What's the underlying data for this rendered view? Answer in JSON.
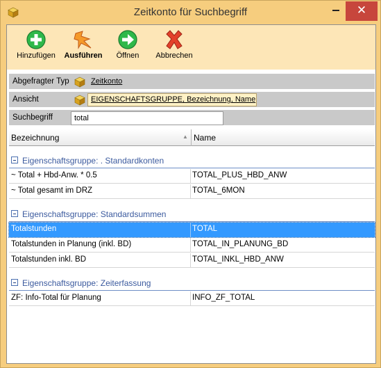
{
  "window": {
    "title": "Zeitkonto für Suchbegriff",
    "close_glyph": "✕",
    "accent_color": "#f6cd7e",
    "close_color": "#c7463c"
  },
  "toolbar": {
    "buttons": [
      {
        "label": "Hinzufügen",
        "icon": "add-icon"
      },
      {
        "label": "Ausführen",
        "icon": "execute-icon"
      },
      {
        "label": "Öffnen",
        "icon": "open-arrow-icon"
      },
      {
        "label": "Abbrechen",
        "icon": "cancel-x-icon"
      }
    ]
  },
  "props": {
    "typ_label": "Abgefragter Typ",
    "typ_value": "Zeitkonto",
    "ansicht_label": "Ansicht",
    "ansicht_value": "EIGENSCHAFTSGRUPPE, Bezeichnung, Name",
    "suchbegriff_label": "Suchbegriff",
    "suchbegriff_value": "total"
  },
  "grid": {
    "columns": [
      "Bezeichnung",
      "Name"
    ],
    "sort_glyph": "▲",
    "groups": [
      {
        "label": "Eigenschaftsgruppe: . Standardkonten",
        "rows": [
          {
            "bezeichnung": "~ Total + Hbd-Anw. * 0.5",
            "name": "TOTAL_PLUS_HBD_ANW"
          },
          {
            "bezeichnung": "~ Total gesamt im DRZ",
            "name": "TOTAL_6MON"
          }
        ]
      },
      {
        "label": "Eigenschaftsgruppe: Standardsummen",
        "rows": [
          {
            "bezeichnung": "Totalstunden",
            "name": "TOTAL"
          },
          {
            "bezeichnung": "Totalstunden in Planung (inkl. BD)",
            "name": "TOTAL_IN_PLANUNG_BD"
          },
          {
            "bezeichnung": "Totalstunden inkl. BD",
            "name": "TOTAL_INKL_HBD_ANW"
          }
        ]
      },
      {
        "label": "Eigenschaftsgruppe: Zeiterfassung",
        "rows": [
          {
            "bezeichnung": "ZF: Info-Total für Planung",
            "name": "INFO_ZF_TOTAL"
          }
        ]
      }
    ]
  }
}
